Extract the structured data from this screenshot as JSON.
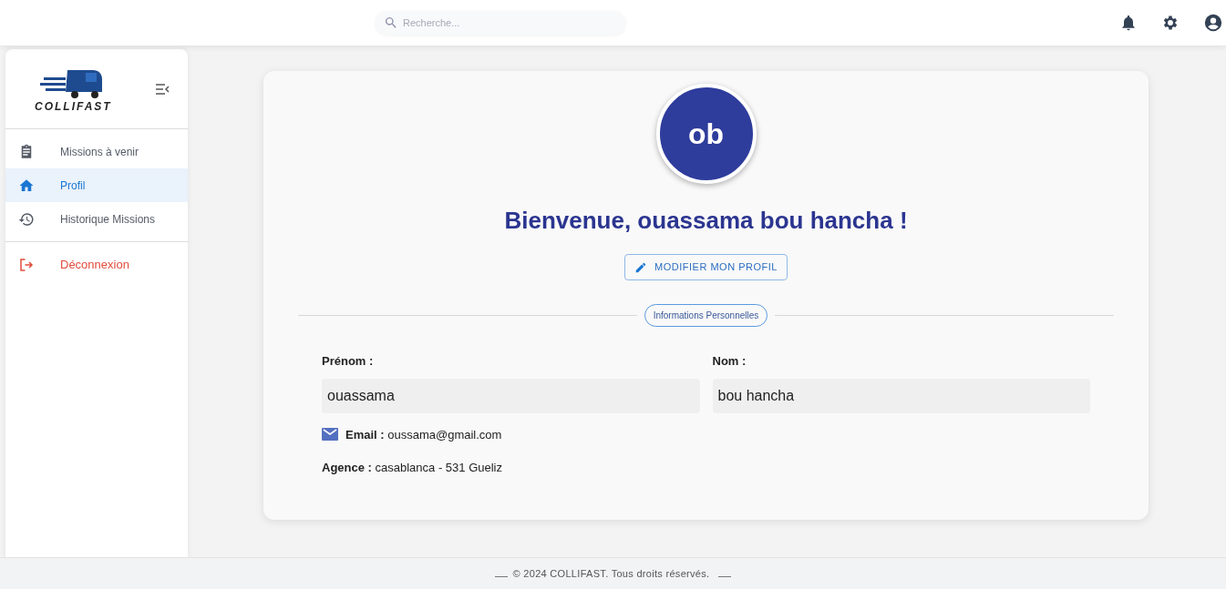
{
  "header": {
    "search": {
      "placeholder": "Recherche..."
    }
  },
  "sidebar": {
    "logo_text": "COLLIFAST",
    "items": [
      {
        "label": "Missions à venir",
        "kind": "nav",
        "selected": false
      },
      {
        "label": "Profil",
        "kind": "nav",
        "selected": true
      },
      {
        "label": "Historique Missions",
        "kind": "nav",
        "selected": false
      },
      {
        "label": "Déconnexion",
        "kind": "logout",
        "selected": false
      }
    ]
  },
  "profile": {
    "avatar": "ob",
    "title": "Bienvenue, ouassama bou hancha !",
    "edit_button": "MODIFIER MON PROFIL",
    "section_chip": "Informations Personnelles",
    "fields": [
      {
        "label": "Prénom :",
        "value": "ouassama"
      },
      {
        "label": "Nom :",
        "value": "bou hancha"
      }
    ],
    "email": {
      "label": "Email :",
      "value": "oussama@gmail.com"
    },
    "agency": {
      "label": "Agence :",
      "value": "casablanca - 531 Gueliz"
    }
  },
  "footer": "© 2024 COLLIFAST. Tous droits réservés."
}
